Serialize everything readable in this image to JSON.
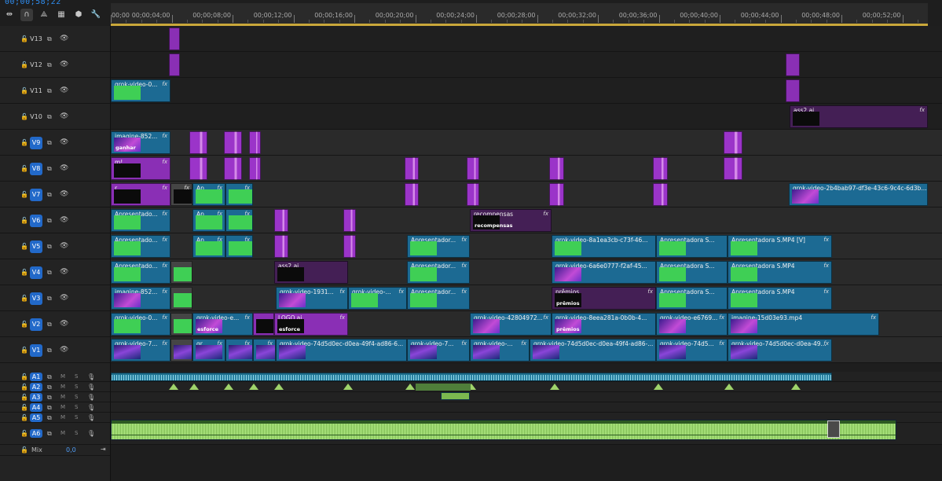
{
  "timecode": "00;00;58;22",
  "toolbar": [
    {
      "name": "snap-icon",
      "glyph": "⇹"
    },
    {
      "name": "linked-selection-icon",
      "glyph": "∩"
    },
    {
      "name": "add-marker-icon",
      "glyph": "⟁"
    },
    {
      "name": "track-settings-icon",
      "glyph": "▦"
    },
    {
      "name": "marker-icon",
      "glyph": "⬢"
    },
    {
      "name": "wrench-icon",
      "glyph": "🔧"
    }
  ],
  "ruler_labels": [
    "00;00",
    "00;00;04;00",
    "00;00;08;00",
    "00;00;12;00",
    "00;00;16;00",
    "00;00;20;00",
    "00;00;24;00",
    "00;00;28;00",
    "00;00;32;00",
    "00;00;36;00",
    "00;00;40;00",
    "00;00;44;00",
    "00;00;48;00",
    "00;00;52;00"
  ],
  "video_tracks": [
    {
      "label": "V13",
      "targeted": false
    },
    {
      "label": "V12",
      "targeted": false
    },
    {
      "label": "V11",
      "targeted": false
    },
    {
      "label": "V10",
      "targeted": false
    },
    {
      "label": "V9",
      "targeted": true
    },
    {
      "label": "V8",
      "targeted": true
    },
    {
      "label": "V7",
      "targeted": true
    },
    {
      "label": "V6",
      "targeted": true
    },
    {
      "label": "V5",
      "targeted": true
    },
    {
      "label": "V4",
      "targeted": true
    },
    {
      "label": "V3",
      "targeted": true
    },
    {
      "label": "V2",
      "targeted": true
    },
    {
      "label": "V1",
      "targeted": true
    }
  ],
  "audio_tracks": [
    {
      "label": "A1",
      "targeted": true
    },
    {
      "label": "A2",
      "targeted": true
    },
    {
      "label": "A3",
      "targeted": true
    },
    {
      "label": "A4",
      "targeted": true
    },
    {
      "label": "A5",
      "targeted": true
    },
    {
      "label": "A6",
      "targeted": true
    }
  ],
  "mute_label": "M",
  "solo_label": "S",
  "mix": {
    "label": "Mix",
    "value": "0,0"
  },
  "clips": [
    {
      "t": 1,
      "s": 74,
      "e": 88,
      "c": "purple"
    },
    {
      "t": 0,
      "s": 74,
      "e": 88,
      "c": "purple"
    },
    {
      "t": 1,
      "s": 859,
      "e": 877,
      "c": "purple"
    },
    {
      "t": 2,
      "s": 859,
      "e": 877,
      "c": "purple"
    },
    {
      "t": 2,
      "s": 0,
      "e": 76,
      "c": "blue",
      "name": "grok-video-0...",
      "fx": true,
      "thumb": "green"
    },
    {
      "t": 3,
      "s": 864,
      "e": 1040,
      "c": "dpurple",
      "name": "ass2.ai",
      "fx": true,
      "thumb": "dark"
    },
    {
      "t": 4,
      "s": 0,
      "e": 76,
      "c": "blue",
      "name": "imagine-852...",
      "fx": true,
      "thumb": "purplepic",
      "ttext": "ganhar"
    },
    {
      "t": 4,
      "s": 100,
      "e": 123,
      "c": "magenta"
    },
    {
      "t": 4,
      "s": 144,
      "e": 167,
      "c": "magenta"
    },
    {
      "t": 4,
      "s": 176,
      "e": 191,
      "c": "magenta"
    },
    {
      "t": 4,
      "s": 780,
      "e": 804,
      "c": "magenta"
    },
    {
      "t": 5,
      "s": 0,
      "e": 76,
      "c": "purple",
      "name": "m!",
      "fx": true,
      "thumb": "dark"
    },
    {
      "t": 5,
      "s": 100,
      "e": 123,
      "c": "magenta"
    },
    {
      "t": 5,
      "s": 144,
      "e": 167,
      "c": "magenta"
    },
    {
      "t": 5,
      "s": 176,
      "e": 191,
      "c": "magenta"
    },
    {
      "t": 5,
      "s": 374,
      "e": 392,
      "c": "magenta"
    },
    {
      "t": 5,
      "s": 453,
      "e": 469,
      "c": "magenta"
    },
    {
      "t": 5,
      "s": 558,
      "e": 577,
      "c": "magenta"
    },
    {
      "t": 5,
      "s": 690,
      "e": 709,
      "c": "magenta"
    },
    {
      "t": 5,
      "s": 780,
      "e": 804,
      "c": "magenta"
    },
    {
      "t": 6,
      "s": 0,
      "e": 76,
      "c": "purple",
      "name": "r",
      "fx": true,
      "thumb": "dark"
    },
    {
      "t": 6,
      "s": 76,
      "e": 104,
      "c": "grey",
      "name": "",
      "fx": true,
      "thumb": "dark"
    },
    {
      "t": 6,
      "s": 104,
      "e": 146,
      "c": "blue",
      "name": "Ap...",
      "fx": true,
      "thumb": "green"
    },
    {
      "t": 6,
      "s": 146,
      "e": 181,
      "c": "blue",
      "name": "",
      "fx": true,
      "thumb": "green"
    },
    {
      "t": 6,
      "s": 374,
      "e": 392,
      "c": "magenta"
    },
    {
      "t": 6,
      "s": 453,
      "e": 469,
      "c": "magenta"
    },
    {
      "t": 6,
      "s": 558,
      "e": 577,
      "c": "magenta"
    },
    {
      "t": 6,
      "s": 690,
      "e": 709,
      "c": "magenta"
    },
    {
      "t": 6,
      "s": 863,
      "e": 1040,
      "c": "blue",
      "name": "grok-video-2b4bab97-df3e-43c6-9c4c-6d3b...",
      "fx": false,
      "thumb": "purplepic"
    },
    {
      "t": 7,
      "s": 0,
      "e": 76,
      "c": "blue",
      "name": "Apresentado...",
      "fx": true,
      "thumb": "green"
    },
    {
      "t": 7,
      "s": 104,
      "e": 146,
      "c": "blue",
      "name": "Ap...",
      "fx": true,
      "thumb": "green"
    },
    {
      "t": 7,
      "s": 146,
      "e": 181,
      "c": "blue",
      "name": "",
      "fx": true,
      "thumb": "green"
    },
    {
      "t": 7,
      "s": 208,
      "e": 226,
      "c": "magenta"
    },
    {
      "t": 7,
      "s": 296,
      "e": 312,
      "c": "magenta"
    },
    {
      "t": 7,
      "s": 457,
      "e": 561,
      "c": "dpurple",
      "name": "recompensas",
      "fx": true,
      "thumb": "dark",
      "ttext": "recompensas"
    },
    {
      "t": 8,
      "s": 0,
      "e": 76,
      "c": "blue",
      "name": "Apresentado...",
      "fx": true,
      "thumb": "green"
    },
    {
      "t": 8,
      "s": 104,
      "e": 146,
      "c": "blue",
      "name": "Ap...",
      "fx": true,
      "thumb": "green"
    },
    {
      "t": 8,
      "s": 146,
      "e": 181,
      "c": "blue",
      "name": "",
      "fx": true,
      "thumb": "green"
    },
    {
      "t": 8,
      "s": 208,
      "e": 226,
      "c": "magenta"
    },
    {
      "t": 8,
      "s": 296,
      "e": 312,
      "c": "magenta"
    },
    {
      "t": 8,
      "s": 377,
      "e": 457,
      "c": "blue",
      "name": "Apresentador...",
      "fx": true,
      "thumb": "green"
    },
    {
      "t": 8,
      "s": 561,
      "e": 694,
      "c": "blue",
      "name": "grok-video-8a1ea3cb-c73f-46...",
      "fx": false,
      "thumb": "green"
    },
    {
      "t": 8,
      "s": 694,
      "e": 785,
      "c": "blue",
      "name": "Apresentadora S...",
      "fx": false,
      "thumb": "green"
    },
    {
      "t": 8,
      "s": 785,
      "e": 918,
      "c": "blue",
      "name": "Apresentadora S.MP4 [V]",
      "fx": true,
      "thumb": "green"
    },
    {
      "t": 9,
      "s": 0,
      "e": 76,
      "c": "blue",
      "name": "Apresentado...",
      "fx": true,
      "thumb": "green"
    },
    {
      "t": 9,
      "s": 76,
      "e": 104,
      "c": "grey",
      "name": "",
      "fx": false,
      "thumb": "green"
    },
    {
      "t": 9,
      "s": 208,
      "e": 302,
      "c": "dpurple",
      "name": "ass2.ai",
      "fx": false,
      "thumb": "dark"
    },
    {
      "t": 9,
      "s": 377,
      "e": 457,
      "c": "blue",
      "name": "Apresentador...",
      "fx": true,
      "thumb": "green"
    },
    {
      "t": 9,
      "s": 561,
      "e": 694,
      "c": "blue",
      "name": "grok-video-6a6e0777-f2af-45...",
      "fx": false,
      "thumb": "purplepic"
    },
    {
      "t": 9,
      "s": 694,
      "e": 785,
      "c": "blue",
      "name": "Apresentadora S...",
      "fx": false,
      "thumb": "green"
    },
    {
      "t": 9,
      "s": 785,
      "e": 918,
      "c": "blue",
      "name": "Apresentadora S.MP4",
      "fx": true,
      "thumb": "green"
    },
    {
      "t": 10,
      "s": 0,
      "e": 76,
      "c": "blue",
      "name": "imagine-852...",
      "fx": true,
      "thumb": "purplepic"
    },
    {
      "t": 10,
      "s": 76,
      "e": 104,
      "c": "grey",
      "name": "",
      "fx": false,
      "thumb": "green"
    },
    {
      "t": 10,
      "s": 210,
      "e": 302,
      "c": "blue",
      "name": "grok-video-1931...",
      "fx": true,
      "thumb": "purplepic"
    },
    {
      "t": 10,
      "s": 302,
      "e": 377,
      "c": "blue",
      "name": "grok-video-...",
      "fx": true,
      "thumb": "green"
    },
    {
      "t": 10,
      "s": 377,
      "e": 457,
      "c": "blue",
      "name": "Apresentador...",
      "fx": true,
      "thumb": "green"
    },
    {
      "t": 10,
      "s": 561,
      "e": 694,
      "c": "dpurple",
      "name": "prêmios",
      "fx": true,
      "thumb": "dark",
      "ttext": "prêmios"
    },
    {
      "t": 10,
      "s": 694,
      "e": 785,
      "c": "blue",
      "name": "Apresentadora S...",
      "fx": false,
      "thumb": "green"
    },
    {
      "t": 10,
      "s": 785,
      "e": 918,
      "c": "blue",
      "name": "Apresentadora S.MP4",
      "fx": true,
      "thumb": "green"
    },
    {
      "t": 11,
      "s": 0,
      "e": 76,
      "c": "blue",
      "name": "grok-video-0...",
      "fx": true,
      "thumb": "green"
    },
    {
      "t": 11,
      "s": 76,
      "e": 104,
      "c": "grey",
      "name": "",
      "fx": false,
      "thumb": "green"
    },
    {
      "t": 11,
      "s": 104,
      "e": 181,
      "c": "blue",
      "name": "grok-video-e...",
      "fx": true,
      "thumb": "purplepic",
      "ttext": "esforce"
    },
    {
      "t": 11,
      "s": 181,
      "e": 208,
      "c": "purple",
      "name": "",
      "fx": false,
      "thumb": "dark"
    },
    {
      "t": 11,
      "s": 208,
      "e": 302,
      "c": "purple",
      "name": "LOGO.ai",
      "fx": true,
      "thumb": "dark",
      "ttext": "esforce"
    },
    {
      "t": 11,
      "s": 457,
      "e": 561,
      "c": "blue",
      "name": "grok-video-42804972...",
      "fx": true,
      "thumb": "purplepic"
    },
    {
      "t": 11,
      "s": 561,
      "e": 694,
      "c": "blue",
      "name": "grok-video-8eea281a-0b0b-4...",
      "fx": false,
      "thumb": "purplepic",
      "ttext": "prêmios"
    },
    {
      "t": 11,
      "s": 694,
      "e": 785,
      "c": "blue",
      "name": "grok-video-e6769...",
      "fx": true,
      "thumb": "purplepic"
    },
    {
      "t": 11,
      "s": 785,
      "e": 978,
      "c": "blue",
      "name": "imagine-15d03e93.mp4",
      "fx": true,
      "thumb": "purplepic"
    },
    {
      "t": 12,
      "s": 0,
      "e": 76,
      "c": "blue",
      "name": "grok-video-7...",
      "fx": true,
      "thumb": "stripe"
    },
    {
      "t": 12,
      "s": 76,
      "e": 104,
      "c": "grey",
      "name": "",
      "fx": false,
      "thumb": "stripe"
    },
    {
      "t": 12,
      "s": 104,
      "e": 146,
      "c": "blue",
      "name": "gr...",
      "fx": true,
      "thumb": "stripe"
    },
    {
      "t": 12,
      "s": 146,
      "e": 181,
      "c": "blue",
      "name": "",
      "fx": true,
      "thumb": "stripe"
    },
    {
      "t": 12,
      "s": 181,
      "e": 210,
      "c": "blue",
      "name": "",
      "fx": true,
      "thumb": "stripe"
    },
    {
      "t": 12,
      "s": 210,
      "e": 377,
      "c": "blue",
      "name": "grok-video-74d5d0ec-d0ea-49f4-ad86-6...",
      "fx": false,
      "thumb": "stripe"
    },
    {
      "t": 12,
      "s": 377,
      "e": 457,
      "c": "blue",
      "name": "grok-video-7...",
      "fx": true,
      "thumb": "stripe"
    },
    {
      "t": 12,
      "s": 457,
      "e": 533,
      "c": "blue",
      "name": "grok-video-...",
      "fx": true,
      "thumb": "stripe"
    },
    {
      "t": 12,
      "s": 533,
      "e": 694,
      "c": "blue",
      "name": "grok-video-74d5d0ec-d0ea-49f4-ad86-...",
      "fx": false,
      "thumb": "stripe"
    },
    {
      "t": 12,
      "s": 694,
      "e": 785,
      "c": "blue",
      "name": "grok-video-74d5...",
      "fx": true,
      "thumb": "stripe"
    },
    {
      "t": 12,
      "s": 785,
      "e": 918,
      "c": "blue",
      "name": "grok-video-74d5d0ec-d0ea-49...",
      "fx": true,
      "thumb": "stripe"
    }
  ],
  "transitions": [
    74,
    100,
    144,
    176,
    208,
    296,
    375,
    453,
    559,
    691,
    781,
    866
  ],
  "colors": {
    "accent": "#2269c9",
    "timecode": "#2f8df0",
    "clip_blue": "#1c6a93",
    "clip_purple": "#8a2fb5",
    "audio_green": "#9fd36a",
    "workarea": "#c9a73a"
  }
}
